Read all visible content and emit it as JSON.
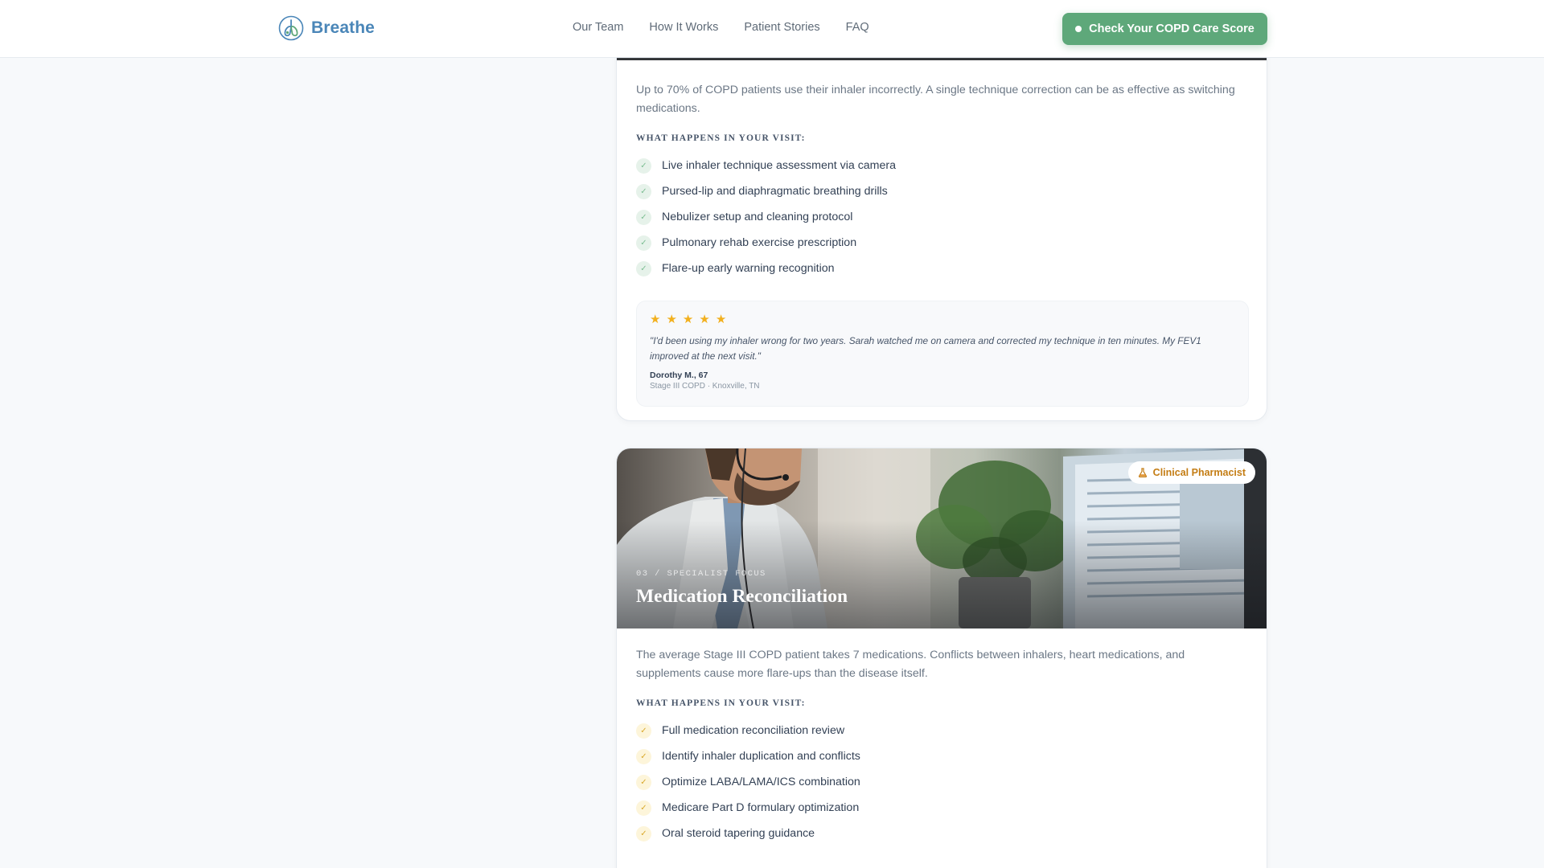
{
  "header": {
    "brand": "Breathe",
    "nav": [
      "Our Team",
      "How It Works",
      "Patient Stories",
      "FAQ"
    ],
    "cta_label": "Check Your COPD Care Score"
  },
  "colors": {
    "brand_blue": "#4a86b8",
    "cta_green": "#5ea87a",
    "star_gold": "#f2b01e",
    "badge_amber": "#c47d14"
  },
  "cards": [
    {
      "intro": "Up to 70% of COPD patients use their inhaler incorrectly. A single technique correction can be as effective as switching medications.",
      "visit_label": "WHAT HAPPENS IN YOUR VISIT:",
      "check_color": "green",
      "items": [
        "Live inhaler technique assessment via camera",
        "Pursed-lip and diaphragmatic breathing drills",
        "Nebulizer setup and cleaning protocol",
        "Pulmonary rehab exercise prescription",
        "Flare-up early warning recognition"
      ],
      "testimonial": {
        "stars": [
          "★",
          "★",
          "★",
          "★",
          "★"
        ],
        "rating": 5,
        "quote": "\"I'd been using my inhaler wrong for two years. Sarah watched me on camera and corrected my technique in ten minutes. My FEV1 improved at the next visit.\"",
        "name": "Dorothy M., 67",
        "meta": "Stage III COPD · Knoxville, TN"
      }
    },
    {
      "badge": "Clinical Pharmacist",
      "badge_icon": "flask-icon",
      "kicker": "03 / SPECIALIST FOCUS",
      "title": "Medication Reconciliation",
      "intro": "The average Stage III COPD patient takes 7 medications. Conflicts between inhalers, heart medications, and supplements cause more flare-ups than the disease itself.",
      "visit_label": "WHAT HAPPENS IN YOUR VISIT:",
      "check_color": "yellow",
      "items": [
        "Full medication reconciliation review",
        "Identify inhaler duplication and conflicts",
        "Optimize LABA/LAMA/ICS combination",
        "Medicare Part D formulary optimization",
        "Oral steroid tapering guidance"
      ]
    }
  ],
  "check_glyph": "✓"
}
